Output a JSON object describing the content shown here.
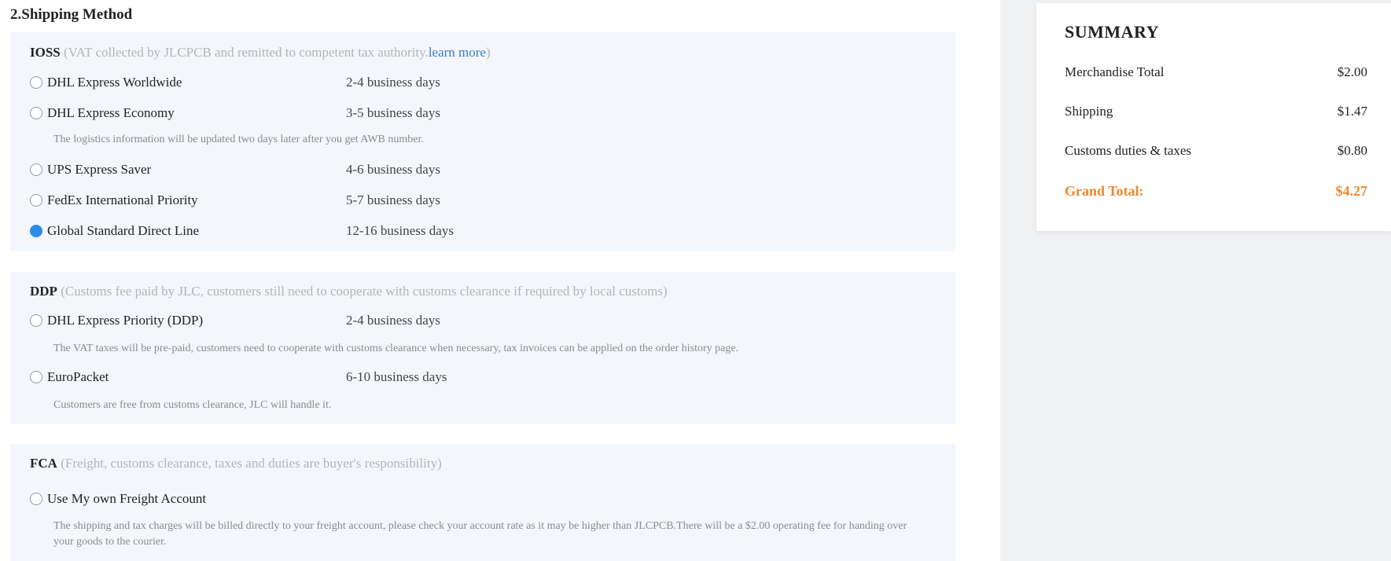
{
  "section": {
    "title": "2.Shipping Method"
  },
  "ioss": {
    "code": "IOSS",
    "desc_open": " (VAT collected by JLCPCB and remitted to competent tax authority.",
    "link": "learn more",
    "desc_close": ")",
    "options": [
      {
        "name": "DHL Express Worldwide",
        "days": "2-4 business days",
        "selected": false
      },
      {
        "name": "DHL Express Economy",
        "days": "3-5 business days",
        "selected": false
      },
      {
        "name": "UPS Express Saver",
        "days": "4-6 business days",
        "selected": false
      },
      {
        "name": "FedEx International Priority",
        "days": "5-7 business days",
        "selected": false
      },
      {
        "name": "Global Standard Direct Line",
        "days": "12-16 business days",
        "selected": true
      }
    ],
    "note_economy": "The logistics information will be updated two days later after you get AWB number."
  },
  "ddp": {
    "code": "DDP",
    "desc": " (Customs fee paid by JLC, customers still need to cooperate with customs clearance if required by local customs)",
    "options": [
      {
        "name": "DHL Express Priority (DDP)",
        "days": "2-4 business days",
        "selected": false
      },
      {
        "name": "EuroPacket",
        "days": "6-10 business days",
        "selected": false
      }
    ],
    "note_dhl": "The VAT taxes will be pre-paid, customers need to cooperate with customs clearance when necessary, tax invoices can be applied on the order history page.",
    "note_euro": "Customers are free from customs clearance, JLC will handle it."
  },
  "fca": {
    "code": "FCA",
    "desc": " (Freight, customs clearance, taxes and duties are buyer's responsibility)",
    "options": [
      {
        "name": "Use My own Freight Account",
        "selected": false
      }
    ],
    "note": "The shipping and tax charges will be billed directly to your freight account, please check your account rate as it may be higher than JLCPCB.There will be a $2.00 operating fee for handing over your goods to the courier."
  },
  "summary": {
    "title": "SUMMARY",
    "rows": [
      {
        "label": "Merchandise Total",
        "value": "$2.00"
      },
      {
        "label": "Shipping",
        "value": "$1.47"
      },
      {
        "label": "Customs duties & taxes",
        "value": "$0.80"
      }
    ],
    "total": {
      "label": "Grand Total:",
      "value": "$4.27"
    }
  },
  "colors": {
    "accent": "#2f8be8",
    "total": "#f0882b",
    "link": "#3a7bd5"
  }
}
